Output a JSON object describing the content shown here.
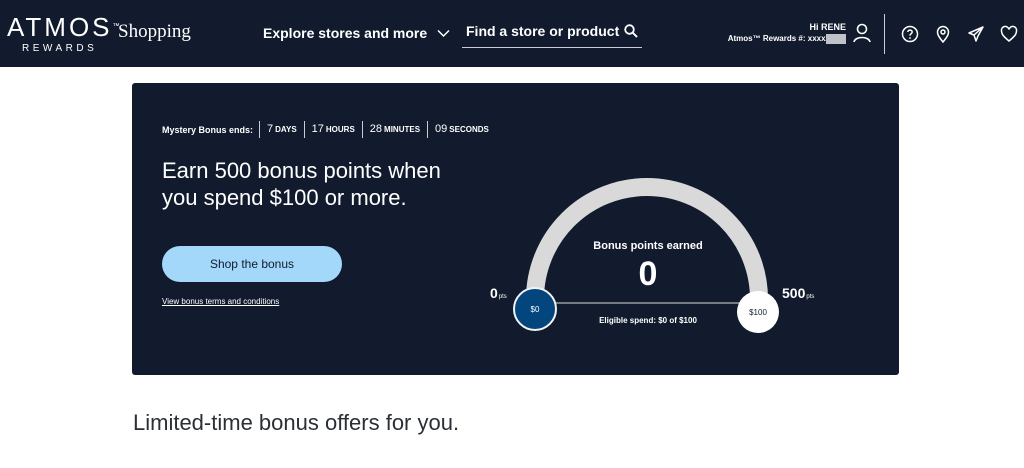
{
  "header": {
    "brand_name": "ATMOS",
    "brand_tm": "™",
    "brand_sub": "REWARDS",
    "shop_label": "Shopping",
    "explore_label": "Explore stores and more",
    "search_label": "Find a store or product",
    "greeting": "Hi RENE",
    "account_label": "Atmos™ Rewards #: xxxxx",
    "icons": [
      "chevron-down-icon",
      "search-icon",
      "user-icon",
      "help-icon",
      "location-pin-icon",
      "airplane-icon",
      "heart-icon"
    ]
  },
  "promo": {
    "timer_label": "Mystery Bonus ends:",
    "timer": [
      {
        "num": "7",
        "unit": "DAYS"
      },
      {
        "num": "17",
        "unit": "HOURS"
      },
      {
        "num": "28",
        "unit": "MINUTES"
      },
      {
        "num": "09",
        "unit": "SECONDS"
      }
    ],
    "headline": "Earn 500 bonus points when you spend $100 or more.",
    "cta_label": "Shop the bonus",
    "terms_label": "View bonus terms and conditions"
  },
  "gauge": {
    "title": "Bonus points earned",
    "value": "0",
    "progress": 0,
    "min_label": "0",
    "max_label": "500",
    "unit": "pts",
    "start_knob": "$0",
    "end_knob": "$100",
    "spend_text": "Eligible spend: $0 of $100"
  },
  "section_title": "Limited-time bonus offers for you.",
  "colors": {
    "navy": "#111b2d",
    "button": "#a3d8fb",
    "knob": "#03467e",
    "arc": "#d9d9d9"
  }
}
